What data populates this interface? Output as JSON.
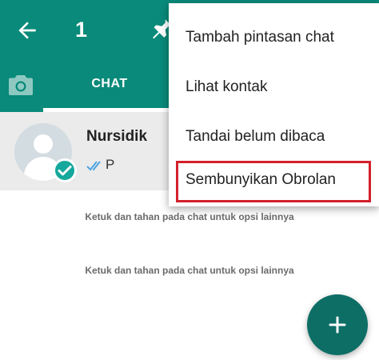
{
  "appbar": {
    "selected_count": "1"
  },
  "tabs": {
    "chat_label": "CHAT"
  },
  "chat": {
    "name": "Nursidik",
    "preview": "P"
  },
  "hints": [
    "Ketuk dan tahan pada chat untuk opsi lainnya",
    "Ketuk dan tahan pada chat untuk opsi lainnya"
  ],
  "menu": {
    "items": [
      {
        "label": "Tambah pintasan chat"
      },
      {
        "label": "Lihat kontak"
      },
      {
        "label": "Tandai belum dibaca"
      },
      {
        "label": "Sembunyikan Obrolan"
      }
    ]
  },
  "colors": {
    "primary": "#098a7a",
    "fab": "#0d6e66",
    "check": "#15a89c",
    "highlight": "#d4202b",
    "tick": "#4fa3e0"
  },
  "icons": {
    "back": "arrow-back-icon",
    "pin": "pin-icon",
    "camera": "camera-icon",
    "selected": "check-icon",
    "read_receipt": "double-tick-icon",
    "new_chat": "plus-icon"
  }
}
